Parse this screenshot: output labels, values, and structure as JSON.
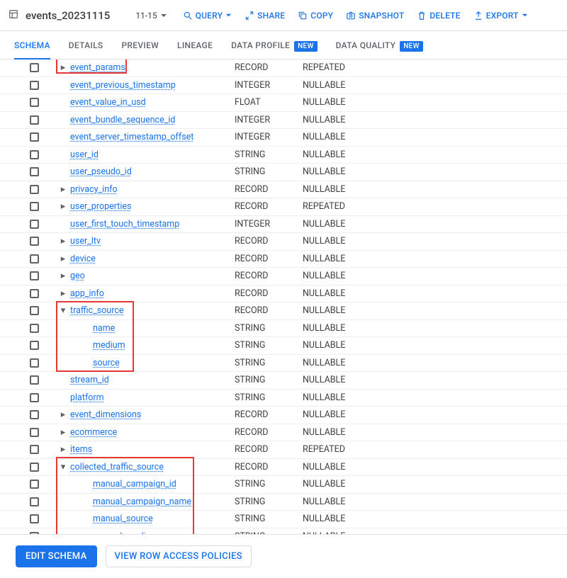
{
  "titlebar": {
    "table_name": "events_20231115",
    "range": "11-15",
    "actions": {
      "query": "QUERY",
      "share": "SHARE",
      "copy": "COPY",
      "snapshot": "SNAPSHOT",
      "delete": "DELETE",
      "export": "EXPORT"
    }
  },
  "tabs": {
    "schema": "SCHEMA",
    "details": "DETAILS",
    "preview": "PREVIEW",
    "lineage": "LINEAGE",
    "data_profile": "DATA PROFILE",
    "data_quality": "DATA QUALITY",
    "new_badge": "NEW"
  },
  "schema": {
    "rows": [
      {
        "indent": 0,
        "exp": "closed",
        "name": "event_params",
        "type": "RECORD",
        "mode": "REPEATED"
      },
      {
        "indent": 0,
        "exp": null,
        "name": "event_previous_timestamp",
        "type": "INTEGER",
        "mode": "NULLABLE"
      },
      {
        "indent": 0,
        "exp": null,
        "name": "event_value_in_usd",
        "type": "FLOAT",
        "mode": "NULLABLE"
      },
      {
        "indent": 0,
        "exp": null,
        "name": "event_bundle_sequence_id",
        "type": "INTEGER",
        "mode": "NULLABLE"
      },
      {
        "indent": 0,
        "exp": null,
        "name": "event_server_timestamp_offset",
        "type": "INTEGER",
        "mode": "NULLABLE"
      },
      {
        "indent": 0,
        "exp": null,
        "name": "user_id",
        "type": "STRING",
        "mode": "NULLABLE"
      },
      {
        "indent": 0,
        "exp": null,
        "name": "user_pseudo_id",
        "type": "STRING",
        "mode": "NULLABLE"
      },
      {
        "indent": 0,
        "exp": "closed",
        "name": "privacy_info",
        "type": "RECORD",
        "mode": "NULLABLE"
      },
      {
        "indent": 0,
        "exp": "closed",
        "name": "user_properties",
        "type": "RECORD",
        "mode": "REPEATED"
      },
      {
        "indent": 0,
        "exp": null,
        "name": "user_first_touch_timestamp",
        "type": "INTEGER",
        "mode": "NULLABLE"
      },
      {
        "indent": 0,
        "exp": "closed",
        "name": "user_ltv",
        "type": "RECORD",
        "mode": "NULLABLE"
      },
      {
        "indent": 0,
        "exp": "closed",
        "name": "device",
        "type": "RECORD",
        "mode": "NULLABLE"
      },
      {
        "indent": 0,
        "exp": "closed",
        "name": "geo",
        "type": "RECORD",
        "mode": "NULLABLE"
      },
      {
        "indent": 0,
        "exp": "closed",
        "name": "app_info",
        "type": "RECORD",
        "mode": "NULLABLE"
      },
      {
        "indent": 0,
        "exp": "open",
        "name": "traffic_source",
        "type": "RECORD",
        "mode": "NULLABLE"
      },
      {
        "indent": 1,
        "exp": null,
        "name": "name",
        "type": "STRING",
        "mode": "NULLABLE"
      },
      {
        "indent": 1,
        "exp": null,
        "name": "medium",
        "type": "STRING",
        "mode": "NULLABLE"
      },
      {
        "indent": 1,
        "exp": null,
        "name": "source",
        "type": "STRING",
        "mode": "NULLABLE"
      },
      {
        "indent": 0,
        "exp": null,
        "name": "stream_id",
        "type": "STRING",
        "mode": "NULLABLE"
      },
      {
        "indent": 0,
        "exp": null,
        "name": "platform",
        "type": "STRING",
        "mode": "NULLABLE"
      },
      {
        "indent": 0,
        "exp": "closed",
        "name": "event_dimensions",
        "type": "RECORD",
        "mode": "NULLABLE"
      },
      {
        "indent": 0,
        "exp": "closed",
        "name": "ecommerce",
        "type": "RECORD",
        "mode": "NULLABLE"
      },
      {
        "indent": 0,
        "exp": "closed",
        "name": "items",
        "type": "RECORD",
        "mode": "REPEATED"
      },
      {
        "indent": 0,
        "exp": "open",
        "name": "collected_traffic_source",
        "type": "RECORD",
        "mode": "NULLABLE"
      },
      {
        "indent": 1,
        "exp": null,
        "name": "manual_campaign_id",
        "type": "STRING",
        "mode": "NULLABLE"
      },
      {
        "indent": 1,
        "exp": null,
        "name": "manual_campaign_name",
        "type": "STRING",
        "mode": "NULLABLE"
      },
      {
        "indent": 1,
        "exp": null,
        "name": "manual_source",
        "type": "STRING",
        "mode": "NULLABLE"
      },
      {
        "indent": 1,
        "exp": null,
        "name": "manual_medium",
        "type": "STRING",
        "mode": "NULLABLE"
      }
    ]
  },
  "footer": {
    "edit_schema": "EDIT SCHEMA",
    "row_access": "VIEW ROW ACCESS POLICIES"
  }
}
